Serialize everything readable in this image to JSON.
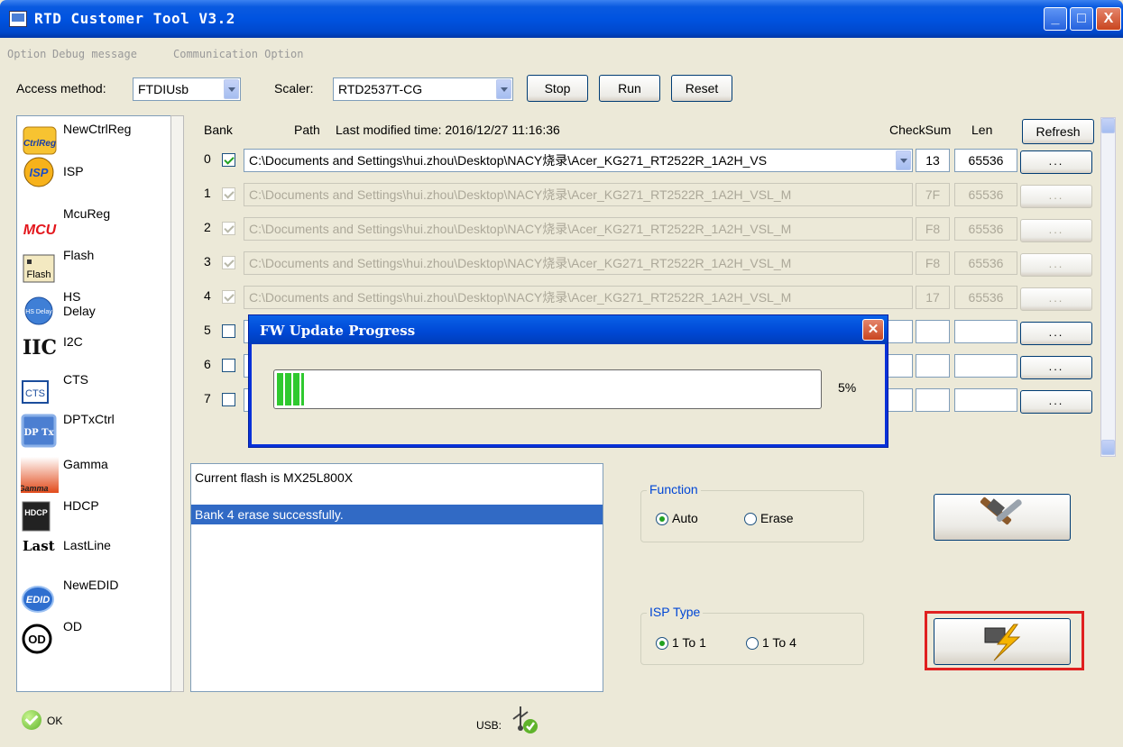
{
  "window": {
    "title": "RTD Customer Tool V3.2"
  },
  "titlebar_buttons": {
    "minimize": "_",
    "maximize": "□",
    "close": "X"
  },
  "menu": [
    "Option",
    "Debug message",
    "Communication Option"
  ],
  "toolbar": {
    "access_label": "Access method:",
    "access_value": "FTDIUsb",
    "scaler_label": "Scaler:",
    "scaler_value": "RTD2537T-CG",
    "stop": "Stop",
    "run": "Run",
    "reset": "Reset"
  },
  "sidebar": {
    "items": [
      {
        "label": "NewCtrlReg",
        "icon": "ctrlreg-icon",
        "icon_text": "CtrlReg"
      },
      {
        "label": "ISP",
        "icon": "isp-icon",
        "icon_text": "ISP"
      },
      {
        "label": "McuReg",
        "icon": "mcu-icon",
        "icon_text": "MCU"
      },
      {
        "label": "Flash",
        "icon": "flash-chip-icon",
        "icon_text": "Flash"
      },
      {
        "label": "HS Delay",
        "icon": "hs-delay-icon",
        "icon_text": "HS Delay"
      },
      {
        "label": "I2C",
        "icon": "i2c-icon",
        "icon_text": "IIC"
      },
      {
        "label": "CTS",
        "icon": "cts-icon",
        "icon_text": "CTS"
      },
      {
        "label": "DPTxCtrl",
        "icon": "dptx-icon",
        "icon_text": "DP Tx"
      },
      {
        "label": "Gamma",
        "icon": "gamma-icon",
        "icon_text": "Gamma"
      },
      {
        "label": "HDCP",
        "icon": "hdcp-icon",
        "icon_text": "HDCP"
      },
      {
        "label": "LastLine",
        "icon": "lastline-icon",
        "icon_text": "Last Line"
      },
      {
        "label": "NewEDID",
        "icon": "edid-icon",
        "icon_text": "EDID"
      },
      {
        "label": "OD",
        "icon": "od-icon",
        "icon_text": "OD"
      }
    ]
  },
  "banks": {
    "headers": {
      "bank": "Bank",
      "path": "Path",
      "modified": "Last modified time: 2016/12/27 11:16:36",
      "checksum": "CheckSum",
      "len": "Len",
      "refresh": "Refresh"
    },
    "dots_label": "...",
    "rows": [
      {
        "index": "0",
        "checked": true,
        "enabled": true,
        "path": "C:\\Documents and Settings\\hui.zhou\\Desktop\\NACY烧录\\Acer_KG271_RT2522R_1A2H_VS",
        "checksum": "13",
        "len": "65536"
      },
      {
        "index": "1",
        "checked": true,
        "enabled": false,
        "path": "C:\\Documents and Settings\\hui.zhou\\Desktop\\NACY烧录\\Acer_KG271_RT2522R_1A2H_VSL_M",
        "checksum": "7F",
        "len": "65536"
      },
      {
        "index": "2",
        "checked": true,
        "enabled": false,
        "path": "C:\\Documents and Settings\\hui.zhou\\Desktop\\NACY烧录\\Acer_KG271_RT2522R_1A2H_VSL_M",
        "checksum": "F8",
        "len": "65536"
      },
      {
        "index": "3",
        "checked": true,
        "enabled": false,
        "path": "C:\\Documents and Settings\\hui.zhou\\Desktop\\NACY烧录\\Acer_KG271_RT2522R_1A2H_VSL_M",
        "checksum": "F8",
        "len": "65536"
      },
      {
        "index": "4",
        "checked": true,
        "enabled": false,
        "path": "C:\\Documents and Settings\\hui.zhou\\Desktop\\NACY烧录\\Acer_KG271_RT2522R_1A2H_VSL_M",
        "checksum": "17",
        "len": "65536"
      },
      {
        "index": "5",
        "checked": false,
        "enabled": true,
        "path": "",
        "checksum": "",
        "len": ""
      },
      {
        "index": "6",
        "checked": false,
        "enabled": true,
        "path": "",
        "checksum": "",
        "len": ""
      },
      {
        "index": "7",
        "checked": false,
        "enabled": true,
        "path": "",
        "checksum": "",
        "len": ""
      }
    ]
  },
  "log": {
    "lines": [
      "Current flash is MX25L800X",
      "",
      "Bank 4 erase successfully."
    ],
    "selected_index": 2
  },
  "function_group": {
    "title": "Function",
    "options": [
      "Auto",
      "Erase"
    ],
    "selected": "Auto"
  },
  "isp_type_group": {
    "title": "ISP Type",
    "options": [
      "1 To 1",
      "1 To 4"
    ],
    "selected": "1 To 1"
  },
  "action_buttons": {
    "tools": "tools-icon",
    "program": "flash-program-icon"
  },
  "status": {
    "ok": "OK",
    "usb": "USB:"
  },
  "dialog": {
    "title": "FW Update Progress",
    "progress": 0.05,
    "percent_label": "5%"
  },
  "colors": {
    "titlebar": "#0053e0",
    "selection": "#316ac5",
    "progress": "#2fc92f",
    "highlight": "#e02020",
    "group_title": "#0046d5"
  }
}
